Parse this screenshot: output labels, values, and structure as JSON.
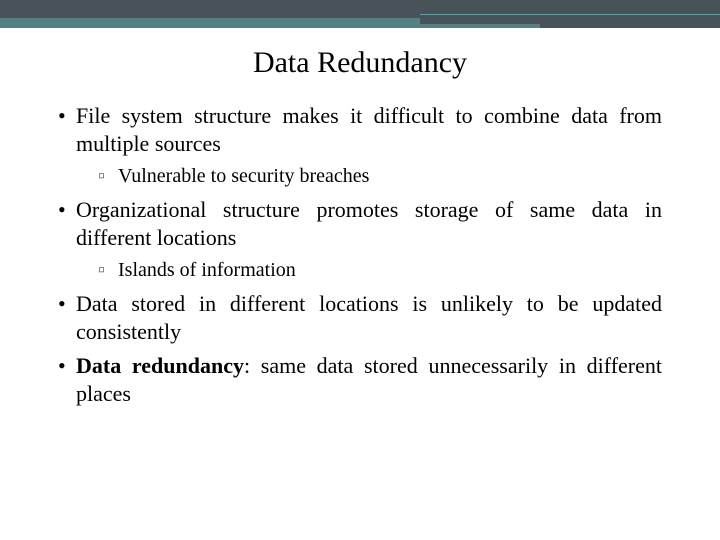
{
  "title": "Data Redundancy",
  "bullets": {
    "b1": "File system structure makes it difficult to combine data from multiple sources",
    "b1_sub": "Vulnerable to security breaches",
    "b2": "Organizational structure promotes storage of same data in different locations",
    "b2_sub": "Islands of information",
    "b3": "Data stored in different locations is unlikely to be updated consistently",
    "b4_bold": "Data redundancy",
    "b4_rest": ": same data stored unnecessarily in different places"
  }
}
